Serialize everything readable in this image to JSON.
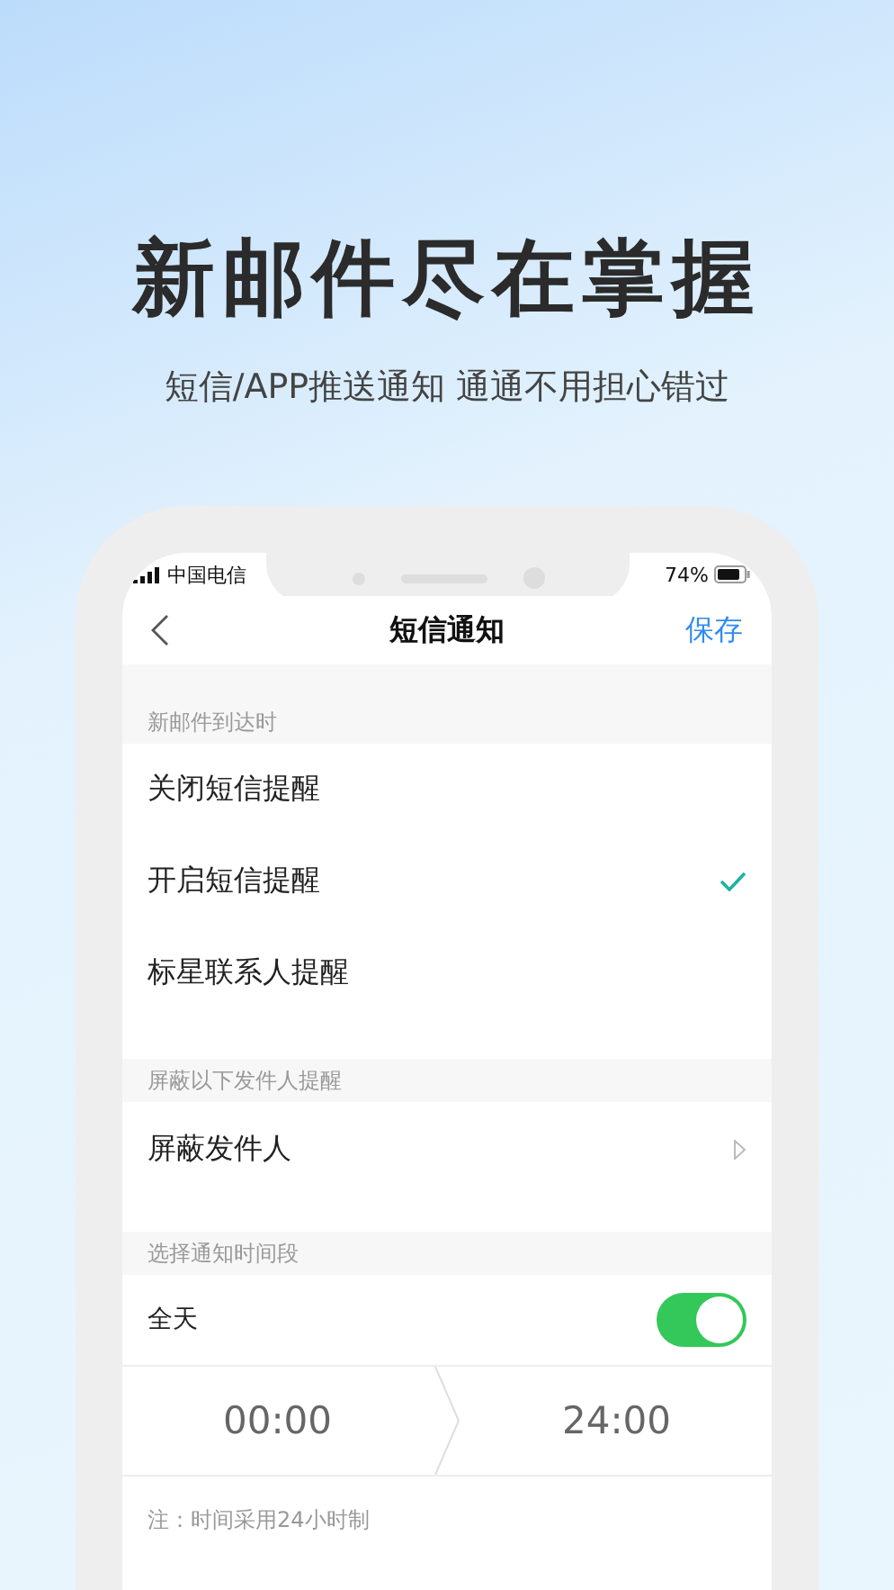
{
  "headline": "新邮件尽在掌握",
  "subtitle": "短信/APP推送通知 通通不用担心错过",
  "status_bar": {
    "carrier": "中国电信",
    "battery": "74%"
  },
  "nav": {
    "title": "短信通知",
    "action": "保存"
  },
  "sections": [
    {
      "header": "新邮件到达时",
      "items": [
        {
          "kind": "option",
          "label": "关闭短信提醒",
          "selected": false
        },
        {
          "kind": "option",
          "label": "开启短信提醒",
          "selected": true
        },
        {
          "kind": "option",
          "label": "标星联系人提醒",
          "selected": false
        }
      ]
    },
    {
      "header": "屏蔽以下发件人提醒",
      "items": [
        {
          "kind": "link",
          "label": "屏蔽发件人"
        }
      ]
    },
    {
      "header": "选择通知时间段",
      "items": [
        {
          "kind": "toggle",
          "label": "全天",
          "on": true
        },
        {
          "kind": "time_range",
          "start": "00:00",
          "end": "24:00"
        },
        {
          "kind": "note",
          "label": "注：时间采用24小时制"
        }
      ]
    }
  ]
}
